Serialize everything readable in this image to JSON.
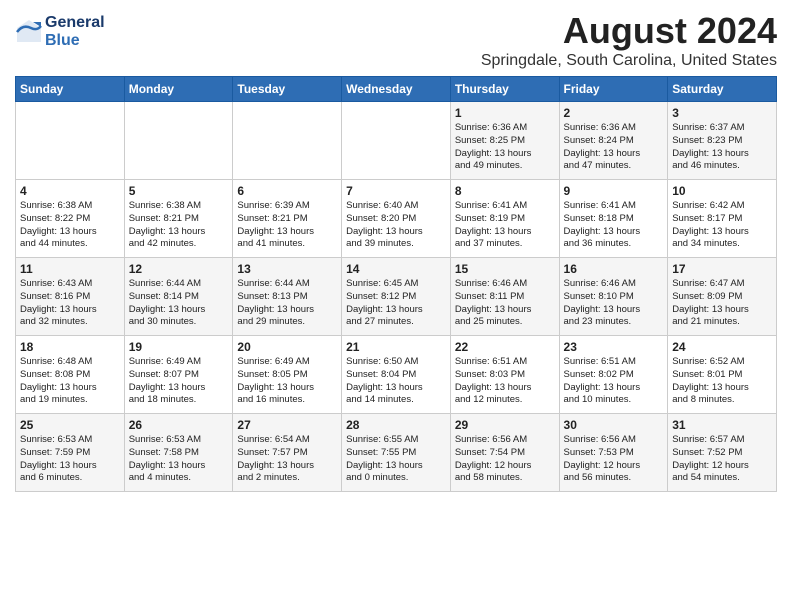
{
  "header": {
    "logo_line1": "General",
    "logo_line2": "Blue",
    "month": "August 2024",
    "location": "Springdale, South Carolina, United States"
  },
  "days_of_week": [
    "Sunday",
    "Monday",
    "Tuesday",
    "Wednesday",
    "Thursday",
    "Friday",
    "Saturday"
  ],
  "weeks": [
    [
      {
        "day": "",
        "info": ""
      },
      {
        "day": "",
        "info": ""
      },
      {
        "day": "",
        "info": ""
      },
      {
        "day": "",
        "info": ""
      },
      {
        "day": "1",
        "info": "Sunrise: 6:36 AM\nSunset: 8:25 PM\nDaylight: 13 hours\nand 49 minutes."
      },
      {
        "day": "2",
        "info": "Sunrise: 6:36 AM\nSunset: 8:24 PM\nDaylight: 13 hours\nand 47 minutes."
      },
      {
        "day": "3",
        "info": "Sunrise: 6:37 AM\nSunset: 8:23 PM\nDaylight: 13 hours\nand 46 minutes."
      }
    ],
    [
      {
        "day": "4",
        "info": "Sunrise: 6:38 AM\nSunset: 8:22 PM\nDaylight: 13 hours\nand 44 minutes."
      },
      {
        "day": "5",
        "info": "Sunrise: 6:38 AM\nSunset: 8:21 PM\nDaylight: 13 hours\nand 42 minutes."
      },
      {
        "day": "6",
        "info": "Sunrise: 6:39 AM\nSunset: 8:21 PM\nDaylight: 13 hours\nand 41 minutes."
      },
      {
        "day": "7",
        "info": "Sunrise: 6:40 AM\nSunset: 8:20 PM\nDaylight: 13 hours\nand 39 minutes."
      },
      {
        "day": "8",
        "info": "Sunrise: 6:41 AM\nSunset: 8:19 PM\nDaylight: 13 hours\nand 37 minutes."
      },
      {
        "day": "9",
        "info": "Sunrise: 6:41 AM\nSunset: 8:18 PM\nDaylight: 13 hours\nand 36 minutes."
      },
      {
        "day": "10",
        "info": "Sunrise: 6:42 AM\nSunset: 8:17 PM\nDaylight: 13 hours\nand 34 minutes."
      }
    ],
    [
      {
        "day": "11",
        "info": "Sunrise: 6:43 AM\nSunset: 8:16 PM\nDaylight: 13 hours\nand 32 minutes."
      },
      {
        "day": "12",
        "info": "Sunrise: 6:44 AM\nSunset: 8:14 PM\nDaylight: 13 hours\nand 30 minutes."
      },
      {
        "day": "13",
        "info": "Sunrise: 6:44 AM\nSunset: 8:13 PM\nDaylight: 13 hours\nand 29 minutes."
      },
      {
        "day": "14",
        "info": "Sunrise: 6:45 AM\nSunset: 8:12 PM\nDaylight: 13 hours\nand 27 minutes."
      },
      {
        "day": "15",
        "info": "Sunrise: 6:46 AM\nSunset: 8:11 PM\nDaylight: 13 hours\nand 25 minutes."
      },
      {
        "day": "16",
        "info": "Sunrise: 6:46 AM\nSunset: 8:10 PM\nDaylight: 13 hours\nand 23 minutes."
      },
      {
        "day": "17",
        "info": "Sunrise: 6:47 AM\nSunset: 8:09 PM\nDaylight: 13 hours\nand 21 minutes."
      }
    ],
    [
      {
        "day": "18",
        "info": "Sunrise: 6:48 AM\nSunset: 8:08 PM\nDaylight: 13 hours\nand 19 minutes."
      },
      {
        "day": "19",
        "info": "Sunrise: 6:49 AM\nSunset: 8:07 PM\nDaylight: 13 hours\nand 18 minutes."
      },
      {
        "day": "20",
        "info": "Sunrise: 6:49 AM\nSunset: 8:05 PM\nDaylight: 13 hours\nand 16 minutes."
      },
      {
        "day": "21",
        "info": "Sunrise: 6:50 AM\nSunset: 8:04 PM\nDaylight: 13 hours\nand 14 minutes."
      },
      {
        "day": "22",
        "info": "Sunrise: 6:51 AM\nSunset: 8:03 PM\nDaylight: 13 hours\nand 12 minutes."
      },
      {
        "day": "23",
        "info": "Sunrise: 6:51 AM\nSunset: 8:02 PM\nDaylight: 13 hours\nand 10 minutes."
      },
      {
        "day": "24",
        "info": "Sunrise: 6:52 AM\nSunset: 8:01 PM\nDaylight: 13 hours\nand 8 minutes."
      }
    ],
    [
      {
        "day": "25",
        "info": "Sunrise: 6:53 AM\nSunset: 7:59 PM\nDaylight: 13 hours\nand 6 minutes."
      },
      {
        "day": "26",
        "info": "Sunrise: 6:53 AM\nSunset: 7:58 PM\nDaylight: 13 hours\nand 4 minutes."
      },
      {
        "day": "27",
        "info": "Sunrise: 6:54 AM\nSunset: 7:57 PM\nDaylight: 13 hours\nand 2 minutes."
      },
      {
        "day": "28",
        "info": "Sunrise: 6:55 AM\nSunset: 7:55 PM\nDaylight: 13 hours\nand 0 minutes."
      },
      {
        "day": "29",
        "info": "Sunrise: 6:56 AM\nSunset: 7:54 PM\nDaylight: 12 hours\nand 58 minutes."
      },
      {
        "day": "30",
        "info": "Sunrise: 6:56 AM\nSunset: 7:53 PM\nDaylight: 12 hours\nand 56 minutes."
      },
      {
        "day": "31",
        "info": "Sunrise: 6:57 AM\nSunset: 7:52 PM\nDaylight: 12 hours\nand 54 minutes."
      }
    ]
  ]
}
